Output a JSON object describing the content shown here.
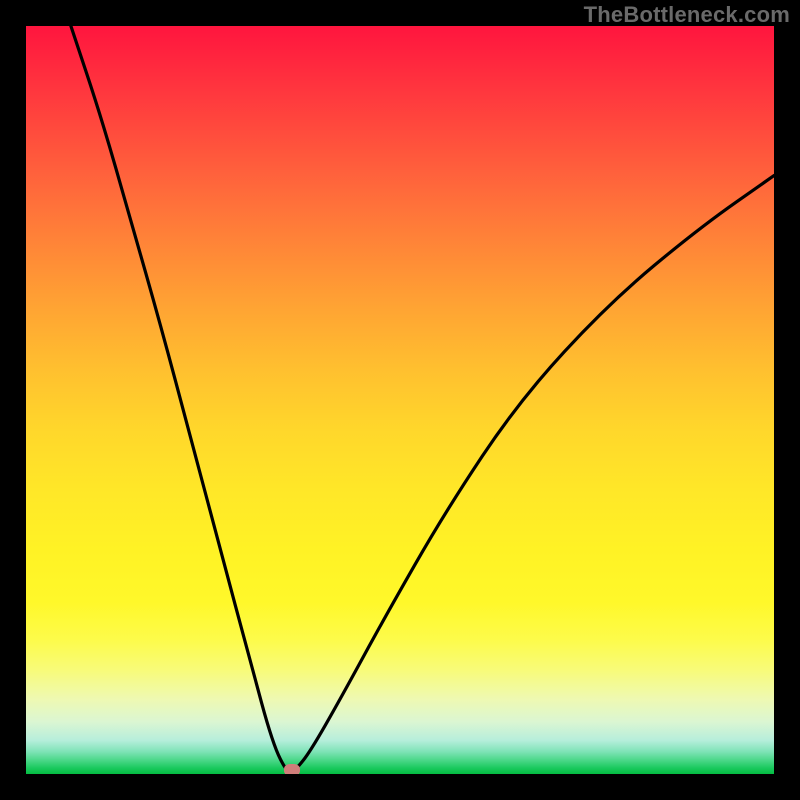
{
  "watermark": "TheBottleneck.com",
  "chart_data": {
    "type": "line",
    "title": "",
    "xlabel": "",
    "ylabel": "",
    "xlim": [
      0,
      100
    ],
    "ylim": [
      0,
      100
    ],
    "grid": false,
    "legend": false,
    "notes": "Black curve resembling a V / absolute-value-like bottleneck curve over a red→yellow→green vertical gradient. Minimum near x≈35, y≈0. Left branch rises steeply toward top-left corner; right branch rises concavely toward upper-right.",
    "series": [
      {
        "name": "bottleneck-curve",
        "x": [
          6,
          10,
          14,
          18,
          22,
          26,
          30,
          33,
          35,
          36,
          38,
          42,
          48,
          56,
          66,
          78,
          90,
          100
        ],
        "y": [
          100,
          88,
          74,
          60,
          45,
          30,
          15,
          4,
          0,
          0.5,
          3,
          10,
          21,
          35,
          50,
          63,
          73,
          80
        ]
      }
    ],
    "marker": {
      "x": 35.5,
      "y": 0.5,
      "color": "#d07e7a"
    },
    "gradient_stops": [
      {
        "pct": 0,
        "color": "#ff153e"
      },
      {
        "pct": 50,
        "color": "#ffd72b"
      },
      {
        "pct": 85,
        "color": "#fcfb60"
      },
      {
        "pct": 100,
        "color": "#04bd42"
      }
    ]
  }
}
